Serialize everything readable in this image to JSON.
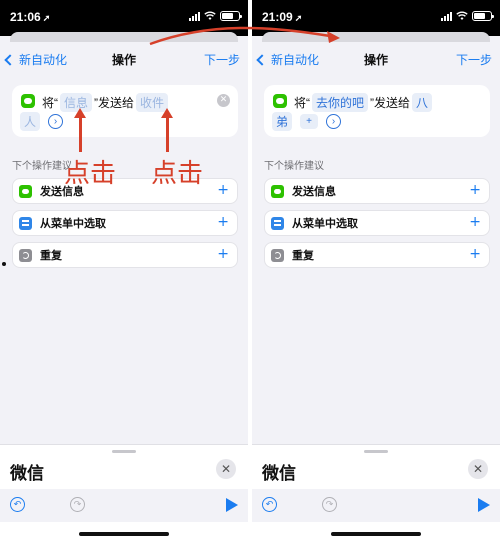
{
  "left": {
    "status": {
      "time": "21:06"
    },
    "nav": {
      "back_label": "新自动化",
      "title": "操作",
      "next_label": "下一步"
    },
    "card": {
      "prefix": "将“",
      "token1": "信息",
      "middle": "”发送给",
      "token2": "收件",
      "line2_text": "人"
    },
    "section_label": "下个操作建议",
    "suggestions": [
      {
        "icon": "message-icon",
        "label": "发送信息"
      },
      {
        "icon": "menu-icon",
        "label": "从菜单中选取"
      },
      {
        "icon": "repeat-icon",
        "label": "重复"
      }
    ],
    "sheet": {
      "title": "微信"
    }
  },
  "right": {
    "status": {
      "time": "21:09"
    },
    "nav": {
      "back_label": "新自动化",
      "title": "操作",
      "next_label": "下一步"
    },
    "card": {
      "prefix": "将“",
      "token1": "去你的吧",
      "middle": "”发送给",
      "token2": "八",
      "line2_text": "弟"
    },
    "section_label": "下个操作建议",
    "suggestions": [
      {
        "icon": "message-icon",
        "label": "发送信息"
      },
      {
        "icon": "menu-icon",
        "label": "从菜单中选取"
      },
      {
        "icon": "repeat-icon",
        "label": "重复"
      }
    ],
    "sheet": {
      "title": "微信"
    }
  },
  "annotations": {
    "label1": "点击",
    "label2": "点击",
    "color": "#d6402a"
  },
  "colors": {
    "accent": "#1a7cf0",
    "wechat_green": "#2dc100"
  }
}
